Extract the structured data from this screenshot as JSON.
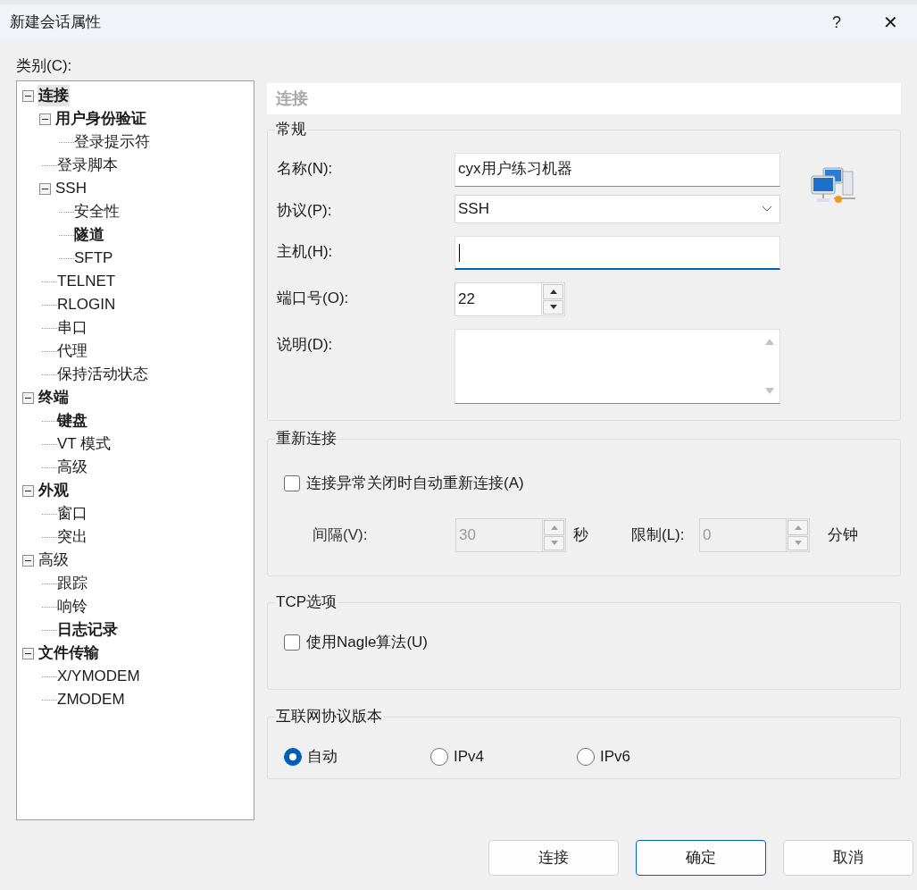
{
  "window": {
    "title": "新建会话属性",
    "help": "?",
    "close": "✕"
  },
  "category_label": "类别(C):",
  "tree": [
    {
      "label": "连接",
      "bold": true,
      "selected": true,
      "expanded": true,
      "children": [
        {
          "label": "用户身份验证",
          "bold": true,
          "selected": false,
          "expanded": true,
          "children": [
            {
              "label": "登录提示符",
              "bold": false,
              "selected": false
            }
          ]
        },
        {
          "label": "登录脚本",
          "bold": false,
          "selected": false
        },
        {
          "label": "SSH",
          "bold": false,
          "selected": false,
          "expanded": true,
          "children": [
            {
              "label": "安全性",
              "bold": false,
              "selected": false
            },
            {
              "label": "隧道",
              "bold": true,
              "selected": false
            },
            {
              "label": "SFTP",
              "bold": false,
              "selected": false
            }
          ]
        },
        {
          "label": "TELNET",
          "bold": false,
          "selected": false
        },
        {
          "label": "RLOGIN",
          "bold": false,
          "selected": false
        },
        {
          "label": "串口",
          "bold": false,
          "selected": false
        },
        {
          "label": "代理",
          "bold": false,
          "selected": false
        },
        {
          "label": "保持活动状态",
          "bold": false,
          "selected": false
        }
      ]
    },
    {
      "label": "终端",
      "bold": true,
      "selected": false,
      "expanded": true,
      "children": [
        {
          "label": "键盘",
          "bold": true,
          "selected": false
        },
        {
          "label": "VT 模式",
          "bold": false,
          "selected": false
        },
        {
          "label": "高级",
          "bold": false,
          "selected": false
        }
      ]
    },
    {
      "label": "外观",
      "bold": true,
      "selected": false,
      "expanded": true,
      "children": [
        {
          "label": "窗口",
          "bold": false,
          "selected": false
        },
        {
          "label": "突出",
          "bold": false,
          "selected": false
        }
      ]
    },
    {
      "label": "高级",
      "bold": false,
      "selected": false,
      "expanded": true,
      "children": [
        {
          "label": "跟踪",
          "bold": false,
          "selected": false
        },
        {
          "label": "响铃",
          "bold": false,
          "selected": false
        },
        {
          "label": "日志记录",
          "bold": true,
          "selected": false
        }
      ]
    },
    {
      "label": "文件传输",
      "bold": true,
      "selected": false,
      "expanded": true,
      "children": [
        {
          "label": "X/YMODEM",
          "bold": false,
          "selected": false
        },
        {
          "label": "ZMODEM",
          "bold": false,
          "selected": false
        }
      ]
    }
  ],
  "page_title": "连接",
  "general": {
    "title": "常规",
    "name_label": "名称(N):",
    "name_value": "cyx用户练习机器",
    "protocol_label": "协议(P):",
    "protocol_value": "SSH",
    "host_label": "主机(H):",
    "port_label": "端口号(O):",
    "port_value": "22",
    "description_label": "说明(D):"
  },
  "reconnect": {
    "title": "重新连接",
    "checkbox_label": "连接异常关闭时自动重新连接(A)",
    "checked": false,
    "interval_label": "间隔(V):",
    "interval_value": "30",
    "interval_unit": "秒",
    "limit_label": "限制(L):",
    "limit_value": "0",
    "limit_unit": "分钟"
  },
  "tcp": {
    "title": "TCP选项",
    "checkbox_label": "使用Nagle算法(U)",
    "checked": false
  },
  "ip_version": {
    "title": "互联网协议版本",
    "options": [
      {
        "label": "自动",
        "selected": true
      },
      {
        "label": "IPv4",
        "selected": false
      },
      {
        "label": "IPv6",
        "selected": false
      }
    ]
  },
  "buttons": [
    {
      "label": "连接",
      "default": false
    },
    {
      "label": "确定",
      "default": true
    },
    {
      "label": "取消",
      "default": false
    }
  ]
}
